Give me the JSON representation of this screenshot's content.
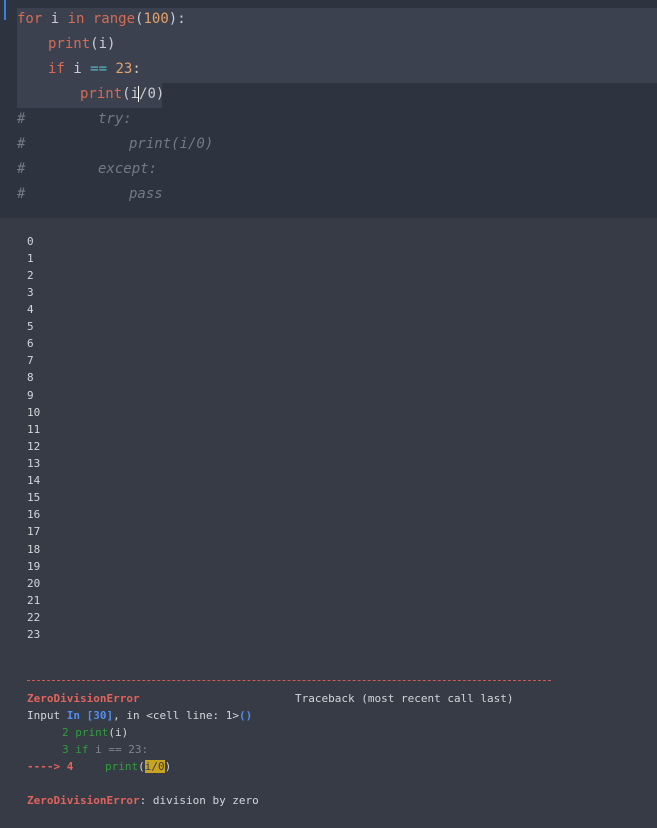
{
  "code": {
    "line1": {
      "kw1": "for",
      "var": " i ",
      "kw2": "in",
      "fn": " range",
      "open": "(",
      "num": "100",
      "close": "):"
    },
    "line2": {
      "fn": "print",
      "rest": "(i)"
    },
    "line3": {
      "kw": "if",
      "var": " i ",
      "op": "==",
      "num": " 23",
      "colon": ":"
    },
    "line4": {
      "fn": "print",
      "a": "(i",
      "b": "/",
      "c": "0)"
    },
    "comments": [
      {
        "hash": "#",
        "text": "try:"
      },
      {
        "hash": "#",
        "text": "print(i/0)"
      },
      {
        "hash": "#",
        "text": "except:"
      },
      {
        "hash": "#",
        "text": "pass"
      }
    ]
  },
  "output": {
    "numbers": [
      "0",
      "1",
      "2",
      "3",
      "4",
      "5",
      "6",
      "7",
      "8",
      "9",
      "10",
      "11",
      "12",
      "13",
      "14",
      "15",
      "16",
      "17",
      "18",
      "19",
      "20",
      "21",
      "22",
      "23"
    ]
  },
  "traceback": {
    "error_name": "ZeroDivisionError",
    "header_right": "Traceback (most recent call last)",
    "input_prefix": "Input ",
    "input_label": "In [30]",
    "input_mid": ", in <cell line: 1>",
    "input_paren": "()",
    "line2_num": "2 ",
    "line2_fn": "print",
    "line2_rest": "(i)",
    "line3_num": "3 ",
    "line3_kw": "if",
    "line3_rest": " i == 23:",
    "arrow": "----> 4",
    "line4_fn": "print",
    "line4_open": "(",
    "line4_hl": "i/0",
    "line4_close": ")",
    "final_name": "ZeroDivisionError",
    "final_msg": ": division by zero"
  }
}
